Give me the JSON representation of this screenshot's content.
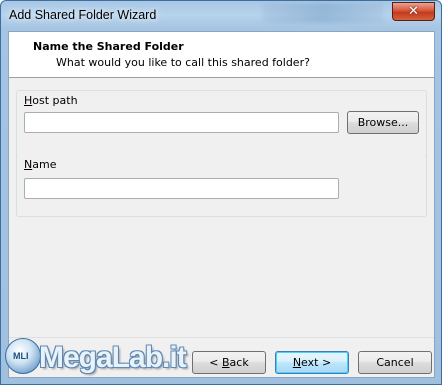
{
  "window": {
    "title": "Add Shared Folder Wizard",
    "close_glyph": "✕"
  },
  "header": {
    "title": "Name the Shared Folder",
    "subtitle": "What would you like to call this shared folder?"
  },
  "host_path": {
    "label_prefix": "",
    "label_mnemonic": "H",
    "label_rest": "ost path",
    "value": "",
    "browse_label": "Browse..."
  },
  "name_field": {
    "label_mnemonic": "N",
    "label_rest": "ame",
    "value": ""
  },
  "footer": {
    "back_prefix": "< ",
    "back_mnemonic": "B",
    "back_rest": "ack",
    "next_mnemonic": "N",
    "next_rest": "ext >",
    "cancel_label": "Cancel"
  },
  "watermark": {
    "badge_text": "MLI",
    "brand_text": "MegaLab.it"
  },
  "icons": {
    "close": "close-icon"
  }
}
